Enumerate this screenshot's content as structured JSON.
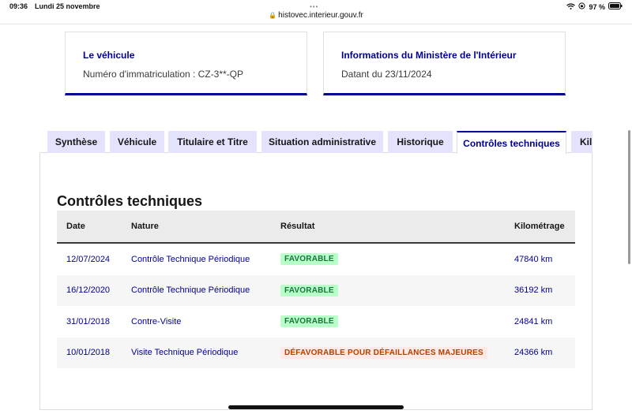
{
  "status": {
    "time": "09:36",
    "date": "Lundi 25 novembre",
    "battery": "97 %"
  },
  "browser": {
    "url": "histovec.interieur.gouv.fr"
  },
  "cards": [
    {
      "title": "Le véhicule",
      "text": "Numéro d'immatriculation : CZ-3**-QP"
    },
    {
      "title": "Informations du Ministère de l'Intérieur",
      "text": "Datant du 23/11/2024"
    }
  ],
  "tabs": [
    "Synthèse",
    "Véhicule",
    "Titulaire et Titre",
    "Situation administrative",
    "Historique",
    "Contrôles techniques",
    "Kil"
  ],
  "active_tab": "Contrôles techniques",
  "section": {
    "title": "Contrôles techniques",
    "headers": [
      "Date",
      "Nature",
      "Résultat",
      "Kilométrage"
    ],
    "rows": [
      {
        "date": "12/07/2024",
        "nature": "Contrôle Technique Périodique",
        "result": "FAVORABLE",
        "km": "47840 km"
      },
      {
        "date": "16/12/2020",
        "nature": "Contrôle Technique Périodique",
        "result": "FAVORABLE",
        "km": "36192 km"
      },
      {
        "date": "31/01/2018",
        "nature": "Contre-Visite",
        "result": "FAVORABLE",
        "km": "24841 km"
      },
      {
        "date": "10/01/2018",
        "nature": "Visite Technique Périodique",
        "result": "DÉFAVORABLE POUR DÉFAILLANCES MAJEURES",
        "km": "24366 km"
      }
    ]
  },
  "colors": {
    "brand": "#000091",
    "favorable_bg": "#b8fec9",
    "favorable_text": "#18753c",
    "defavorable_bg": "#ffe9e6",
    "defavorable_text": "#b34000"
  }
}
